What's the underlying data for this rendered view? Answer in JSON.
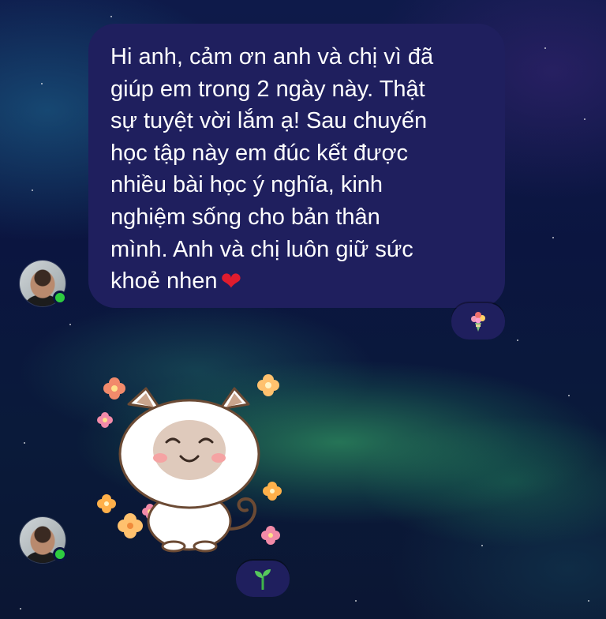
{
  "conversation": {
    "message": {
      "lines": [
        "Hi anh, cảm ơn anh và chị vì đã",
        "giúp em trong 2 ngày này. Thật",
        "sự tuyệt vời lắm ạ! Sau chuyến",
        "học tập này em đúc kết được",
        "nhiều bài học ý nghĩa, kinh",
        "nghiệm sống cho bản thân",
        "mình. Anh và chị luôn giữ sức",
        "khoẻ nhen"
      ],
      "heart_emoji": "❤",
      "reaction_icon": "bouquet-icon"
    },
    "sticker": {
      "icon": "white-cat-with-flowers-sticker",
      "reaction_icon": "seedling-icon"
    },
    "sender_status": "online",
    "colors": {
      "bubble": "#1f1f5e",
      "text": "#ffffff",
      "online_dot": "#2ecc40",
      "heart": "#e01c2e"
    }
  }
}
